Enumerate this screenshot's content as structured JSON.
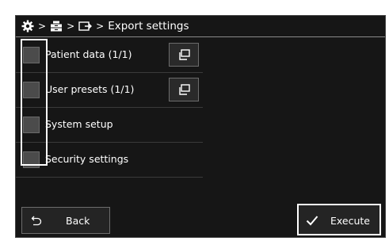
{
  "breadcrumb": {
    "icons": [
      "gear-icon",
      "device-icon",
      "export-icon"
    ],
    "separator": ">",
    "title": "Export settings"
  },
  "items": [
    {
      "label": "Patient data (1/1)",
      "checked": true,
      "has_open_button": true
    },
    {
      "label": "User presets (1/1)",
      "checked": true,
      "has_open_button": true
    },
    {
      "label": "System setup",
      "checked": true,
      "has_open_button": false
    },
    {
      "label": "Security settings",
      "checked": true,
      "has_open_button": false
    }
  ],
  "buttons": {
    "back_label": "Back",
    "back_icon": "return-icon",
    "execute_label": "Execute",
    "execute_icon": "checkmark-icon"
  },
  "colors": {
    "background": "#161616",
    "text": "#ffffff",
    "checkbox_fill": "#4b4b4b",
    "highlight": "#ffffff"
  }
}
